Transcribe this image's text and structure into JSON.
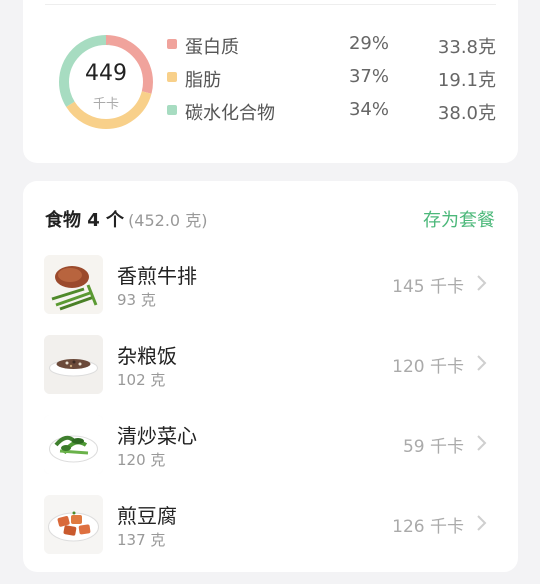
{
  "summary": {
    "total_kcal": "449",
    "kcal_unit": "千卡",
    "macros": [
      {
        "name": "蛋白质",
        "percent": "29%",
        "grams": "33.8克",
        "color": "#f0a39c",
        "fraction": 0.29
      },
      {
        "name": "脂肪",
        "percent": "37%",
        "grams": "19.1克",
        "color": "#f8d08a",
        "fraction": 0.37
      },
      {
        "name": "碳水化合物",
        "percent": "34%",
        "grams": "38.0克",
        "color": "#a7dcc1",
        "fraction": 0.34
      }
    ]
  },
  "foods": {
    "title": "食物 4 个",
    "total_weight": "(452.0 克)",
    "save_label": "存为套餐",
    "items": [
      {
        "name": "香煎牛排",
        "weight": "93 克",
        "kcal": "145 千卡",
        "icon": "steak-icon"
      },
      {
        "name": "杂粮饭",
        "weight": "102 克",
        "kcal": "120 千卡",
        "icon": "rice-icon"
      },
      {
        "name": "清炒菜心",
        "weight": "120 克",
        "kcal": "59 千卡",
        "icon": "greens-icon"
      },
      {
        "name": "煎豆腐",
        "weight": "137 克",
        "kcal": "126 千卡",
        "icon": "tofu-icon"
      }
    ]
  }
}
